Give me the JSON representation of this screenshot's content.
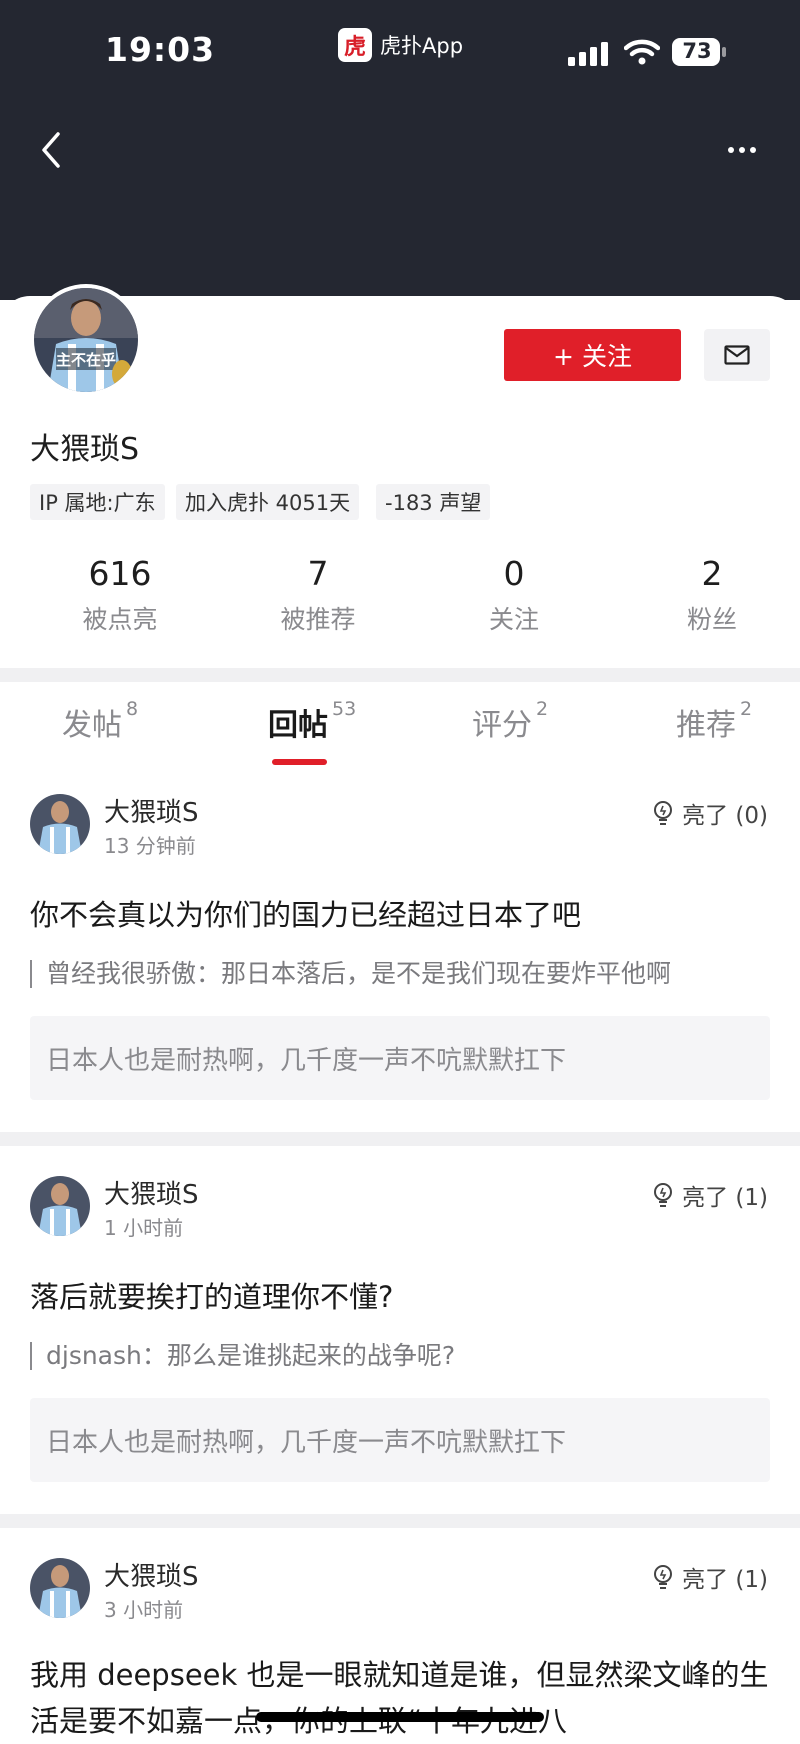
{
  "status_bar": {
    "time": "19:03",
    "app_logo_text": "虎",
    "app_name": "虎扑App",
    "battery": "73"
  },
  "profile": {
    "username": "大猥琐S",
    "avatar_text": "主不在乎",
    "follow_label": "+ 关注",
    "tags": [
      "IP 属地:广东",
      "加入虎扑 4051天",
      "-183 声望"
    ],
    "stats": [
      {
        "value": "616",
        "label": "被点亮"
      },
      {
        "value": "7",
        "label": "被推荐"
      },
      {
        "value": "0",
        "label": "关注"
      },
      {
        "value": "2",
        "label": "粉丝"
      }
    ]
  },
  "tabs": [
    {
      "label": "发帖",
      "count": "8"
    },
    {
      "label": "回帖",
      "count": "53",
      "active": true
    },
    {
      "label": "评分",
      "count": "2"
    },
    {
      "label": "推荐",
      "count": "2"
    }
  ],
  "posts": [
    {
      "author": "大猥琐S",
      "time": "13 分钟前",
      "lights": "亮了 (0)",
      "title": "你不会真以为你们的国力已经超过日本了吧",
      "quote": "曾经我很骄傲：那日本落后，是不是我们现在要炸平他啊",
      "thread": "日本人也是耐热啊，几千度一声不吭默默扛下"
    },
    {
      "author": "大猥琐S",
      "time": "1 小时前",
      "lights": "亮了 (1)",
      "title": "落后就要挨打的道理你不懂?",
      "quote": "djsnash：那么是谁挑起来的战争呢?",
      "thread": "日本人也是耐热啊，几千度一声不吭默默扛下"
    },
    {
      "author": "大猥琐S",
      "time": "3 小时前",
      "lights": "亮了 (1)",
      "body": "我用 deepseek 也是一眼就知道是谁，但显然梁文峰的生活是要不如嘉一点，你的上联“十年九进八"
    }
  ],
  "colors": {
    "header_bg": "#242731",
    "accent": "#e01f29"
  }
}
